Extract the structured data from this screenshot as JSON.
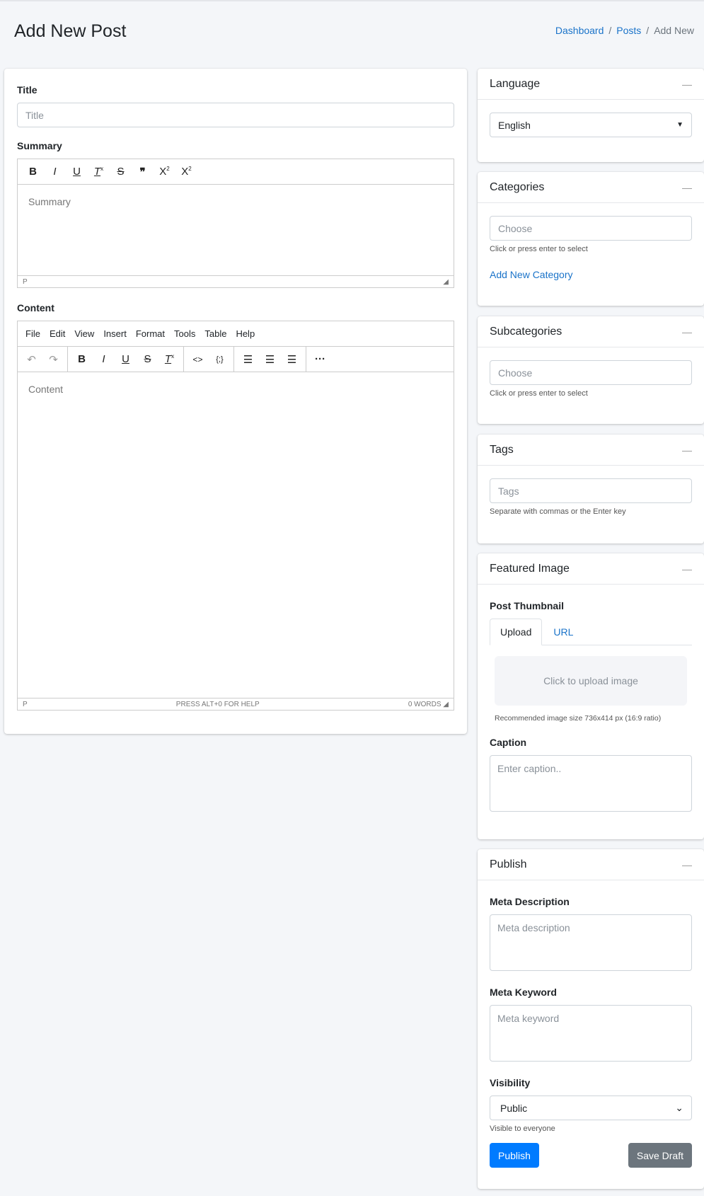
{
  "header": {
    "title": "Add New Post",
    "breadcrumb": [
      "Dashboard",
      "Posts",
      "Add New"
    ]
  },
  "main": {
    "title_label": "Title",
    "title_placeholder": "Title",
    "summary_label": "Summary",
    "summary_placeholder": "Summary",
    "summary_status": "P",
    "summary_toolbar": [
      "bold-icon",
      "italic-icon",
      "underline-icon",
      "clear-format-icon",
      "strikethrough-icon",
      "blockquote-icon",
      "superscript-icon",
      "subscript-icon"
    ],
    "content_label": "Content",
    "menu": [
      "File",
      "Edit",
      "View",
      "Insert",
      "Format",
      "Tools",
      "Table",
      "Help"
    ],
    "content_placeholder": "Content",
    "content_status": "P",
    "content_help": "PRESS ALT+0 FOR HELP",
    "content_words": "0 WORDS"
  },
  "sidebar": {
    "language": {
      "title": "Language",
      "value": "English"
    },
    "categories": {
      "title": "Categories",
      "placeholder": "Choose",
      "help": "Click or press enter to select",
      "add_link": "Add New Category"
    },
    "subcategories": {
      "title": "Subcategories",
      "placeholder": "Choose",
      "help": "Click or press enter to select"
    },
    "tags": {
      "title": "Tags",
      "placeholder": "Tags",
      "help": "Separate with commas or the Enter key"
    },
    "featured": {
      "title": "Featured Image",
      "thumb_label": "Post Thumbnail",
      "tabs": [
        "Upload",
        "URL"
      ],
      "upload_text": "Click to upload image",
      "recommend": "Recommended image size 736x414 px (16:9 ratio)",
      "caption_label": "Caption",
      "caption_placeholder": "Enter caption.."
    },
    "publish": {
      "title": "Publish",
      "meta_desc_label": "Meta Description",
      "meta_desc_placeholder": "Meta description",
      "meta_kw_label": "Meta Keyword",
      "meta_kw_placeholder": "Meta keyword",
      "visibility_label": "Visibility",
      "visibility_value": "Public",
      "visibility_help": "Visible to everyone",
      "publish_btn": "Publish",
      "draft_btn": "Save Draft"
    }
  },
  "colors": {
    "accent": "#007bff",
    "link": "#1a73c9",
    "secondary": "#6c757d"
  }
}
